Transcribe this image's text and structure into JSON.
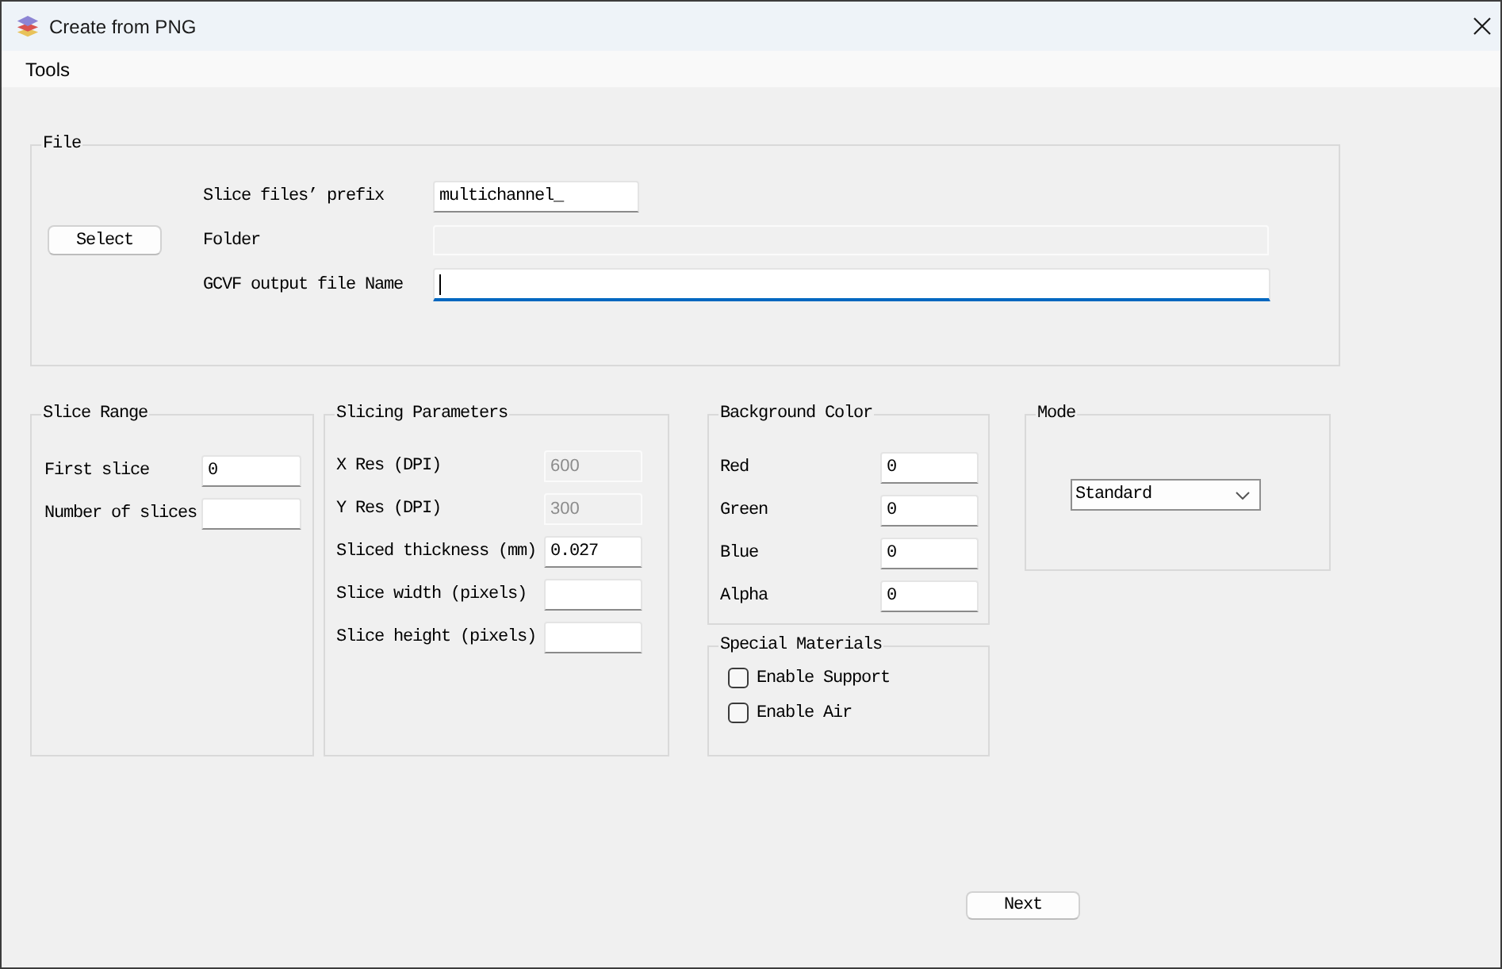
{
  "window": {
    "title": "Create from PNG"
  },
  "menu_bar": {
    "items": [
      "Tools"
    ]
  },
  "file": {
    "title": "File",
    "select_button": "Select",
    "fields": [
      {
        "label": "Slice files’ prefix",
        "value": "multichannel_",
        "disabled": false,
        "focused": false
      },
      {
        "label": "Folder",
        "disabled": true,
        "focused": false
      },
      {
        "label": "GCVF output file Name",
        "disabled": false,
        "focused": true
      }
    ]
  },
  "slice_range": {
    "title": "Slice Range",
    "fields": [
      {
        "label": "First slice",
        "value": "0"
      },
      {
        "label": "Number of slices"
      }
    ]
  },
  "slicing_parameters": {
    "title": "Slicing Parameters",
    "fields": [
      {
        "label": "X Res (DPI)",
        "value": "600",
        "disabled": true
      },
      {
        "label": "Y Res (DPI)",
        "value": "300",
        "disabled": true
      },
      {
        "label": "Sliced thickness (mm)",
        "value": "0.027",
        "disabled": false
      },
      {
        "label": "Slice width (pixels)",
        "disabled": false
      },
      {
        "label": "Slice height (pixels)",
        "disabled": false
      }
    ]
  },
  "background_color": {
    "title": "Background Color",
    "fields": [
      {
        "label": "Red",
        "value": "0"
      },
      {
        "label": "Green",
        "value": "0"
      },
      {
        "label": "Blue",
        "value": "0"
      },
      {
        "label": "Alpha",
        "value": "0"
      }
    ]
  },
  "special_materials": {
    "title": "Special Materials",
    "items": [
      {
        "label": "Enable Support",
        "checked": false
      },
      {
        "label": "Enable Air",
        "checked": false
      }
    ]
  },
  "mode": {
    "title": "Mode",
    "dropdown": {
      "value": "Standard"
    }
  },
  "footer": {
    "next_button": "Next"
  }
}
